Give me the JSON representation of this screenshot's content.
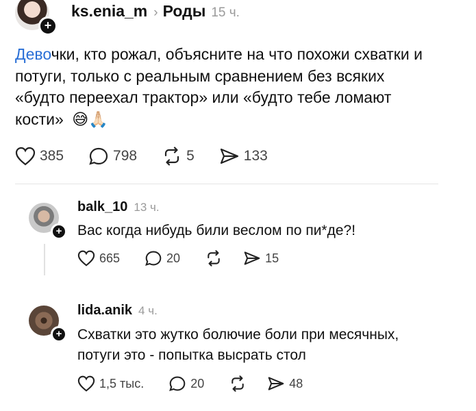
{
  "post": {
    "username": "ks.enia_m",
    "topic": "Роды",
    "time": "15 ч.",
    "text_link": "Дево",
    "text_line1_rest": "чки, кто рожал, объясните на что похожи схватки и",
    "text_line2": "потуги, только с реальным сравнением без всяких",
    "text_line3": "«будто переехал трактор» или «будто тебе ломают",
    "text_line4": "кости»",
    "emoji1": "😅",
    "emoji2": "🙏🏻",
    "likes": "385",
    "comments": "798",
    "reposts": "5",
    "shares": "133"
  },
  "replies": [
    {
      "username": "balk_10",
      "time": "13 ч.",
      "text": "Вас когда нибудь били веслом по пи*де?!",
      "likes": "665",
      "comments": "20",
      "reposts": "",
      "shares": "15"
    },
    {
      "username": "lida.anik",
      "time": "4 ч.",
      "text_line1": "Схватки это жутко болючие боли при месячных,",
      "text_line2": "потуги это - попытка высрать стол",
      "likes": "1,5 тыс.",
      "comments": "20",
      "reposts": "",
      "shares": "48"
    }
  ],
  "colors": {
    "link": "#2a6fd6",
    "muted": "#9a9a9a"
  }
}
